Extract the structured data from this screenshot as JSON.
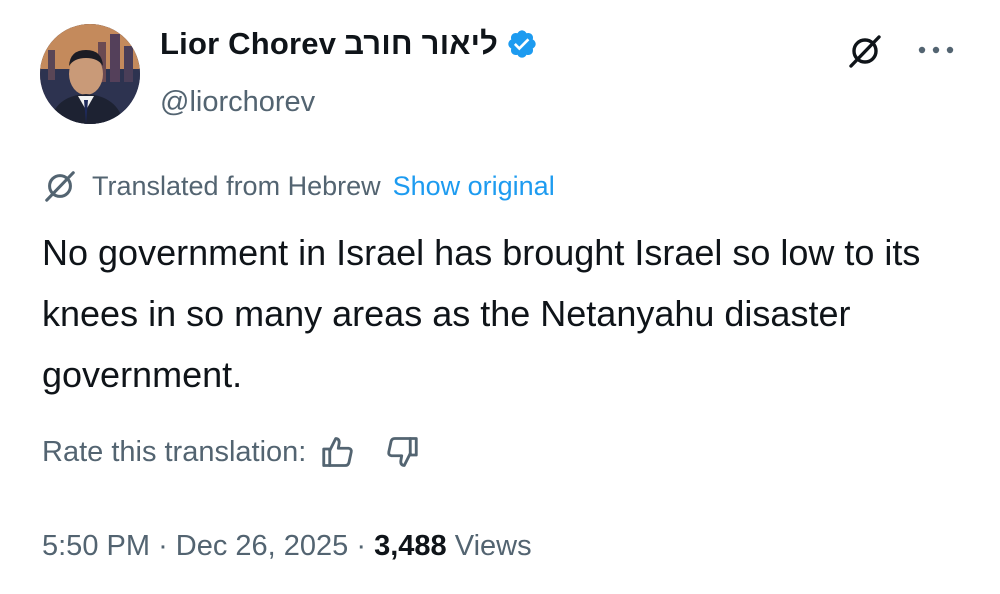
{
  "author": {
    "display_name": "Lior Chorev",
    "display_name_hebrew": "ליאור חורב",
    "handle": "@liorchorev",
    "verified": true
  },
  "translation": {
    "label": "Translated from Hebrew",
    "show_original": "Show original"
  },
  "tweet": {
    "text": "No government in Israel has brought Israel so low to its knees in so many areas as the Netanyahu disaster government."
  },
  "rate": {
    "label": "Rate this translation:"
  },
  "meta": {
    "time": "5:50 PM",
    "separator": "·",
    "date": "Dec 26, 2025",
    "views_count": "3,488",
    "views_label": "Views"
  },
  "icons": {
    "verified": "verified-badge-icon",
    "translate": "grok-translate-icon",
    "more": "more-dots-icon",
    "thumb_up": "thumbs-up-icon",
    "thumb_down": "thumbs-down-icon"
  },
  "colors": {
    "link": "#1d9bf0",
    "secondary_text": "#536471",
    "primary_text": "#0f1419",
    "verified": "#1d9bf0"
  }
}
